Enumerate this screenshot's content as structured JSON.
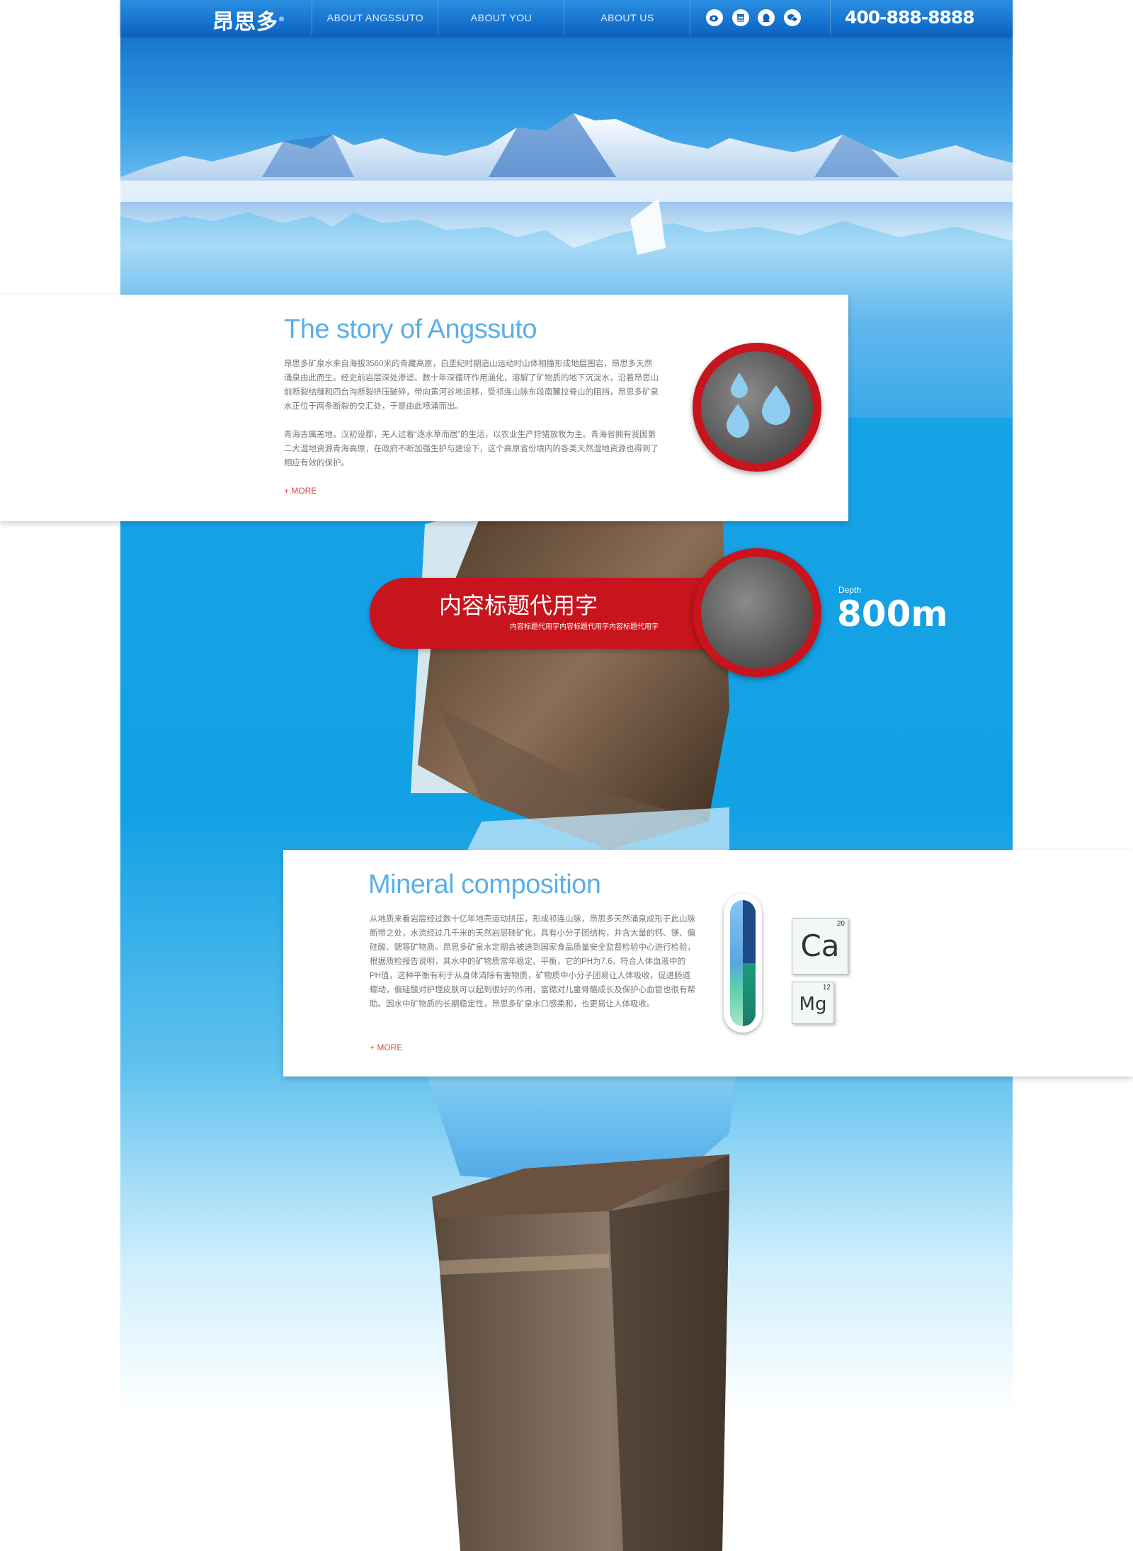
{
  "header": {
    "logo": "昂思多",
    "nav": [
      "ABOUT ANGSSUTO",
      "ABOUT YOU",
      "ABOUT US"
    ],
    "social_icons": [
      "weibo-icon",
      "douban-icon",
      "qq-icon",
      "wechat-icon"
    ],
    "phone": "400-888-8888"
  },
  "story": {
    "title": "The story of Angssuto",
    "paragraph1": "昂思多矿泉水来自海拔3560米的青藏高原，白垩纪时期造山运动时山体相撞形成地层围岩，昂思多天然涌泉由此而生。经史前岩层深处渗滤、数十年深循环作用涵化，溶解了矿物质的地下沉淀水，沿着昂思山前断裂结缝和四台沟断裂挤压破碎，带向黄河谷地运移，受祁连山脉东段南麓拉脊山的阻挡，昂思多矿泉水正位于两条断裂的交汇处，于是由此喷涌而出。",
    "paragraph2": "青海古属羌地，汉初设郡，羌人过着“逐水草而居”的生活，以农业生产狩猎放牧为主。青海省拥有我国第二大湿地资源青海高原，在政府不断加强生护与建设下，这个高原省份境内的各类天然湿地资源也得到了相应有效的保护。",
    "more": "+ MORE"
  },
  "banner": {
    "title": "内容标题代用字",
    "subtitle": "内容标题代用字内容标题代用字内容标题代用字",
    "depth_label": "Depth",
    "depth_value": "800m"
  },
  "mineral": {
    "title": "Mineral composition",
    "paragraph": "从地质来看岩层经过数十亿年地壳运动挤压，形成祁连山脉，昂思多天然涌泉成形于此山脉断带之处，水流经过几千米的天然岩层硅矿化，具有小分子团结构，并含大量的钙、镁、偏硅酸、锶等矿物质。昂思多矿泉水定期会被送到国家食品质量安全监督检验中心进行检验，根据质检报告说明，其水中的矿物质常年稳定、平衡，它的PH为7.6，符合人体血液中的PH值，这种平衡有利于从身体清除有害物质，矿物质中小分子团易让人体吸收，促进肠道蠕动，偏硅酸对护理皮肤可以起到很好的作用，富锶对儿童骨骼成长及保护心血管也很有帮助。因水中矿物质的长期稳定性，昂思多矿泉水口感柔和，也更易让人体吸收。",
    "more": "+ MORE",
    "elements": [
      {
        "symbol": "Ca",
        "number": "20"
      },
      {
        "symbol": "Mg",
        "number": "12"
      }
    ]
  },
  "colors": {
    "brand_blue": "#0b63c3",
    "accent_red": "#c8141c",
    "title_blue": "#5ab0e6"
  }
}
